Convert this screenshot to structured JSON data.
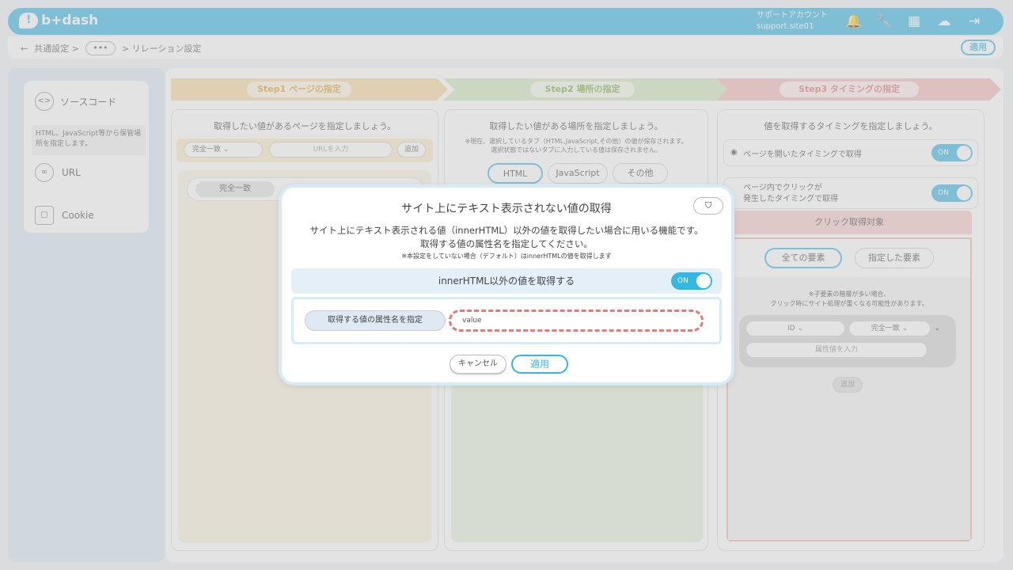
{
  "header": {
    "logo": "b+dash",
    "account_name": "サポートアカウント",
    "account_id": "support.site01"
  },
  "breadcrumb": {
    "back": "←",
    "item1": "共通設定 >",
    "dots": "•••",
    "item2": "> リレーション設定",
    "apply": "適用"
  },
  "sidebar": {
    "source_code": {
      "icon_text": "<>",
      "label": "ソースコード",
      "desc": "HTML、JavaScript等から保管場所を指定します。"
    },
    "url": "URL",
    "cookie": "Cookie"
  },
  "steps": [
    {
      "label": "Step1 ページの指定",
      "color": "#f6d9a0"
    },
    {
      "label": "Step2 場所の指定",
      "color": "#cfe6b8"
    },
    {
      "label": "Step3 タイミングの指定",
      "color": "#f6b8b8"
    }
  ],
  "col1": {
    "title": "取得したい値があるページを指定しましょう。",
    "match_select": "完全一致",
    "url_placeholder": "URLを入力",
    "add": "追加",
    "row_match": "完全一致"
  },
  "col2": {
    "title": "取得したい値がある場所を指定しましょう。",
    "note1": "※現在、選択しているタブ（HTML,JavaScript,その他）の値が保存されます。",
    "note2": "選択状態ではないタブに入力している値は保存されません。",
    "tabs": [
      "HTML",
      "JavaScript",
      "その他"
    ]
  },
  "col3": {
    "title": "値を取得するタイミングを指定しましょう。",
    "opt1": "ページを開いたタイミングで取得",
    "opt2_line1": "ページ内でクリックが",
    "opt2_line2": "発生したタイミングで取得",
    "toggle": "ON",
    "click_target": "クリック取得対象",
    "all_elements": "全ての要素",
    "specified_elements": "指定した要素",
    "warn1": "※子要素の階層が多い場合、",
    "warn2": "クリック時にサイト処理が重くなる可能性があります。",
    "id_select": "ID",
    "match_select": "完全一致",
    "attr_placeholder": "属性値を入力",
    "add": "追加"
  },
  "modal": {
    "title": "サイト上にテキスト表示されない値の取得",
    "help": "?",
    "desc1": "サイト上にテキスト表示される値（innerHTML）以外の値を取得したい場合に用いる機能です。",
    "desc2": "取得する値の属性名を指定してください。",
    "note": "※本設定をしていない場合（デフォルト）はinnerHTMLの値を取得します",
    "band_label": "innerHTML以外の値を取得する",
    "toggle": "ON",
    "attr_label": "取得する値の属性名を指定",
    "attr_value": "value",
    "cancel": "キャンセル",
    "apply": "適用"
  }
}
